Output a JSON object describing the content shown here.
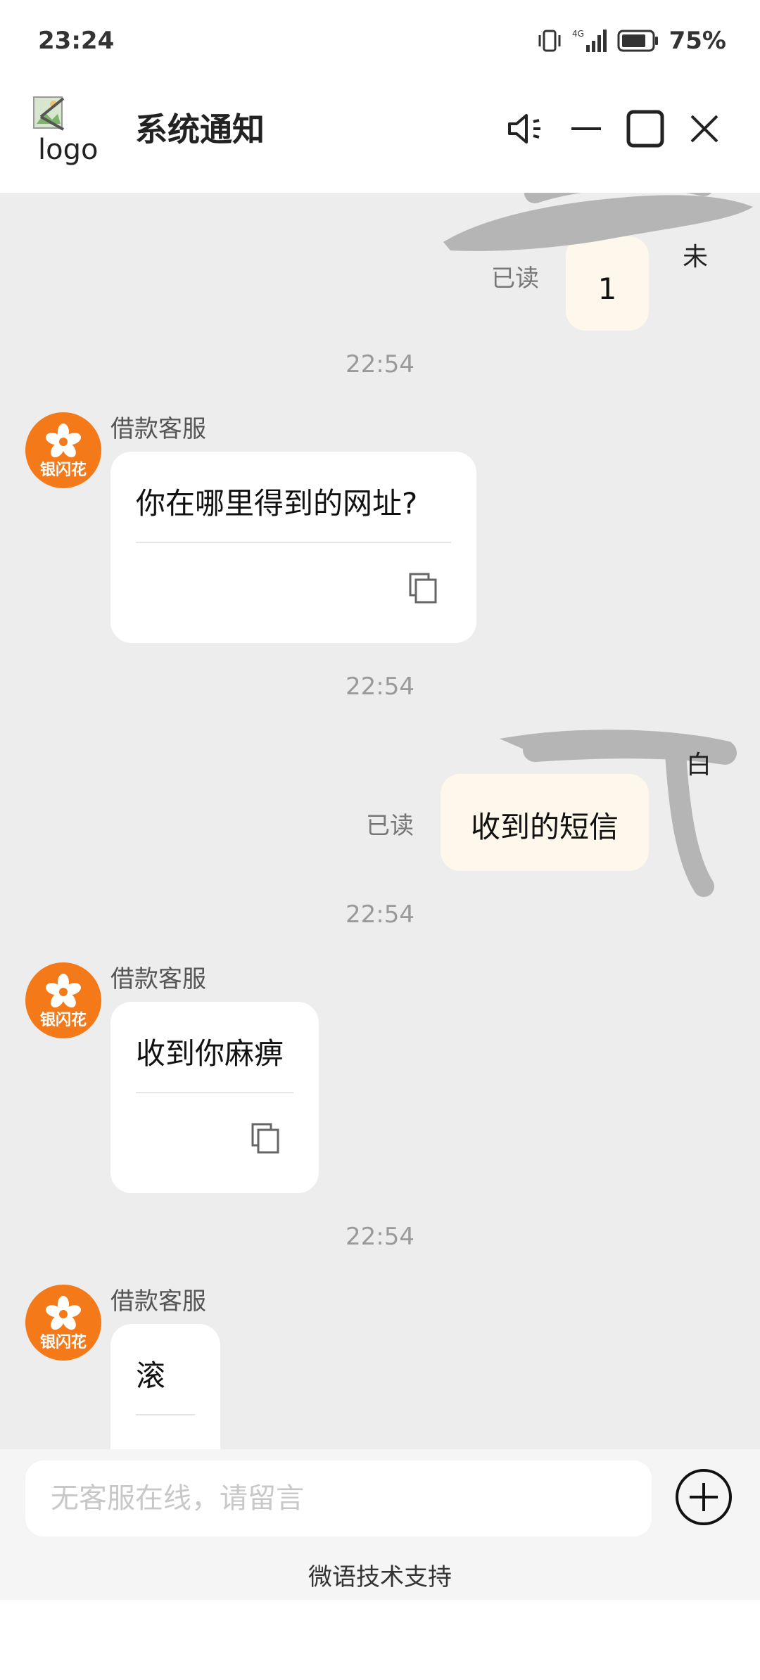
{
  "status_bar": {
    "time": "23:24",
    "network": "4G",
    "battery": "75%"
  },
  "header": {
    "logo_text": "logo",
    "title": "系统通知"
  },
  "messages": [
    {
      "read_label": "已读",
      "text": "1"
    },
    {
      "time": "22:54",
      "sender": "借款客服",
      "avatar_text": "银闪花",
      "text": "你在哪里得到的网址?"
    },
    {
      "time": "22:54",
      "read_label": "已读",
      "text": "收到的短信"
    },
    {
      "time": "22:54",
      "sender": "借款客服",
      "avatar_text": "银闪花",
      "text": "收到你麻痹"
    },
    {
      "time": "22:54",
      "sender": "借款客服",
      "avatar_text": "银闪花",
      "text": "滚"
    }
  ],
  "input": {
    "placeholder": "无客服在线，请留言"
  },
  "footer": {
    "support_text": "微语技术支持"
  },
  "colors": {
    "accent": "#f47a19",
    "chat_bg": "#ededed",
    "out_bubble": "#fdf7ec"
  }
}
